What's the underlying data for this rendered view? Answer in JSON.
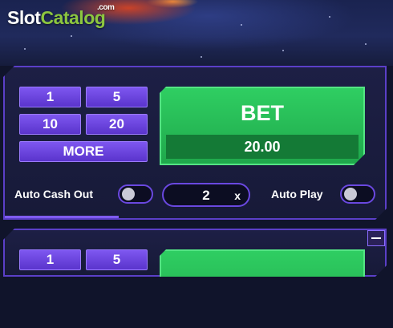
{
  "watermark": {
    "part1": "Slot",
    "part2": "Catalog",
    "suffix": ".com"
  },
  "panel1": {
    "chips": [
      "1",
      "5",
      "10",
      "20"
    ],
    "more_label": "MORE",
    "bet_label": "BET",
    "bet_amount": "20.00",
    "auto_cashout_label": "Auto Cash Out",
    "cashout_value": "2",
    "cashout_suffix": "x",
    "auto_play_label": "Auto Play"
  },
  "panel2": {
    "chips": [
      "1",
      "5"
    ]
  },
  "colors": {
    "accent": "#6a48e0",
    "bet_green": "#2fce62",
    "chip_purple": "#7e57f0",
    "panel_bg": "#1d1f45"
  },
  "icons": [
    "minus-icon"
  ]
}
